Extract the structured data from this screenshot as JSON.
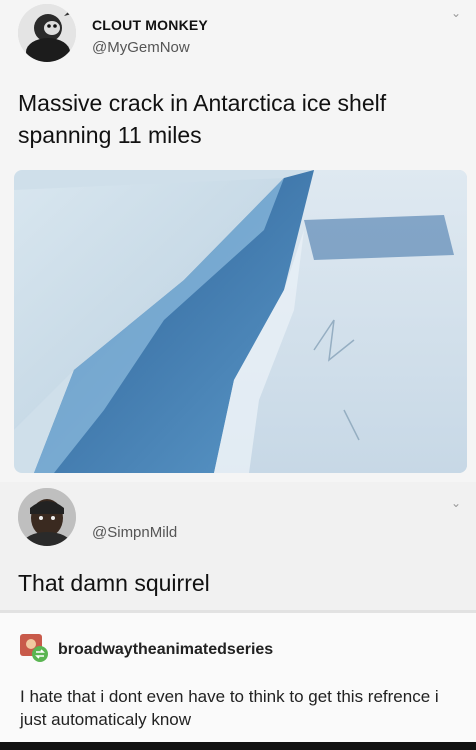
{
  "tweet": {
    "display_name": "CLOUT MONKEY",
    "handle": "@MyGemNow",
    "text": "Massive crack in Antarctica ice shelf spanning 11 miles"
  },
  "reply": {
    "handle": "@SimpnMild",
    "text": "That damn squirrel"
  },
  "tumblr": {
    "username": "broadwaytheanimatedseries",
    "text": "I hate that i dont even have to think to get this refrence i just automaticaly know"
  },
  "icons": {
    "menu": "chevron-down-icon",
    "reblog": "reblog-icon"
  }
}
